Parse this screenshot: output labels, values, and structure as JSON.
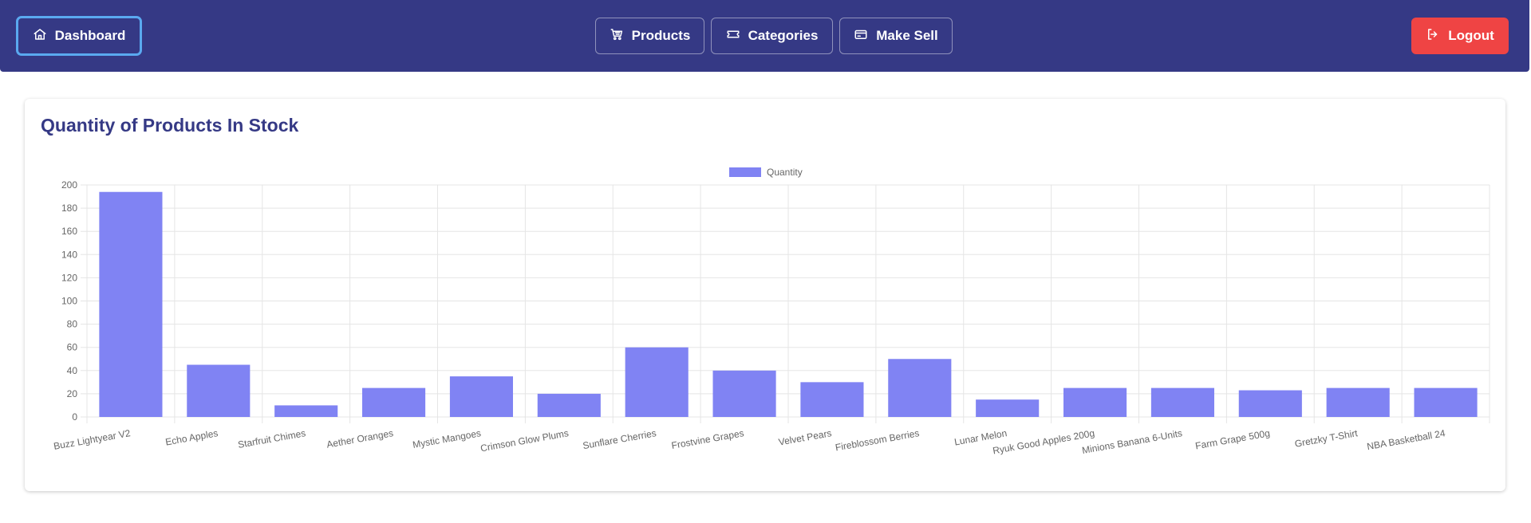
{
  "nav": {
    "dashboard_label": "Dashboard",
    "products_label": "Products",
    "categories_label": "Categories",
    "make_sell_label": "Make Sell",
    "logout_label": "Logout"
  },
  "icons": {
    "dashboard": "home-icon",
    "products": "cart-icon",
    "categories": "ticket-icon",
    "make_sell": "credit-card-icon",
    "logout": "logout-icon"
  },
  "colors": {
    "navbar": "#353985",
    "accent": "#353985",
    "bar": "#8083f3",
    "logout": "#ef4444",
    "dashboard_border": "#5aa9f0"
  },
  "card": {
    "title": "Quantity of Products In Stock"
  },
  "chart_data": {
    "type": "bar",
    "categories": [
      "Buzz Lightyear V2",
      "Echo Apples",
      "Starfruit Chimes",
      "Aether Oranges",
      "Mystic Mangoes",
      "Crimson Glow Plums",
      "Sunflare Cherries",
      "Frostvine Grapes",
      "Velvet Pears",
      "Fireblossom Berries",
      "Lunar Melon",
      "Ryuk Good Apples 200g",
      "Minions Banana 6-Units",
      "Farm Grape 500g",
      "Gretzky T-Shirt",
      "NBA Basketball 24"
    ],
    "series": [
      {
        "name": "Quantity",
        "values": [
          194,
          45,
          10,
          25,
          35,
          20,
          60,
          40,
          30,
          50,
          15,
          25,
          25,
          23,
          25,
          25
        ]
      }
    ],
    "ylim": [
      0,
      200
    ],
    "yticks": [
      0,
      20,
      40,
      60,
      80,
      100,
      120,
      140,
      160,
      180,
      200
    ],
    "grid": true,
    "legend": "top-center",
    "title": "",
    "xlabel": "",
    "ylabel": ""
  }
}
